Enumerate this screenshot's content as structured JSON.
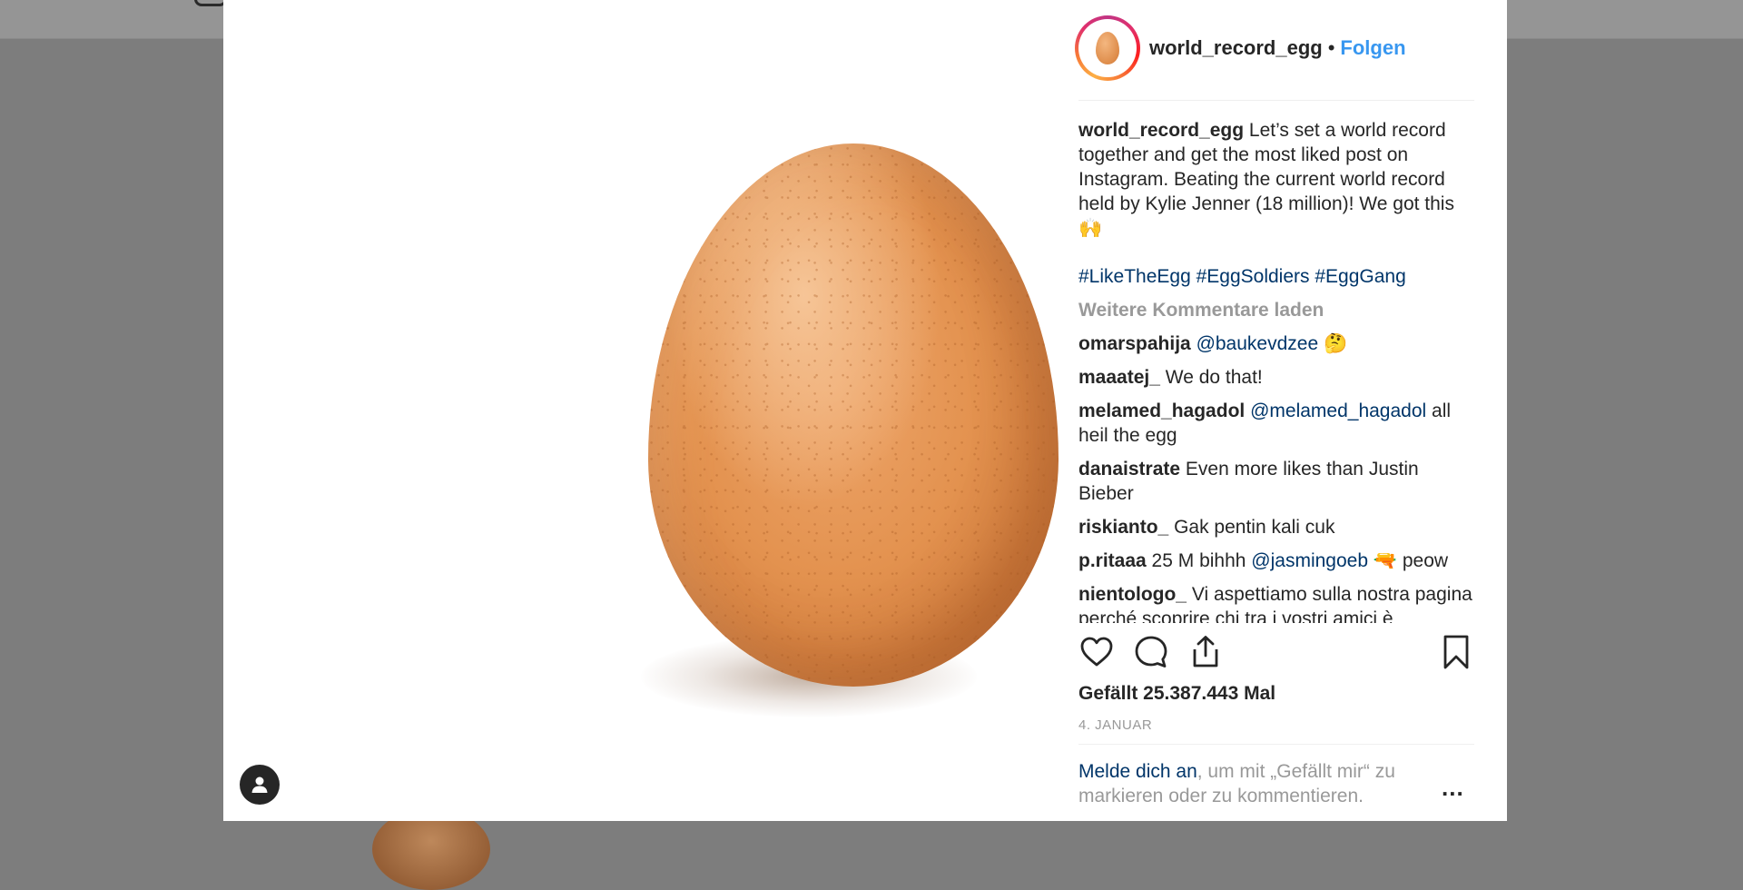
{
  "post": {
    "username": "world_record_egg",
    "separator": "•",
    "follow_label": "Folgen",
    "caption_user": "world_record_egg",
    "caption_text": "Let’s set a world record together and get the most liked post on Instagram. Beating the current world record held by Kylie Jenner (18 million)! We got this 🙌",
    "hashtags": [
      "#LikeTheEgg",
      "#EggSoldiers",
      "#EggGang"
    ],
    "load_more_label": "Weitere Kommentare laden",
    "comments": [
      {
        "user": "omarspahija",
        "mention": "@baukevdzee",
        "text": "🤔"
      },
      {
        "user": "maaatej_",
        "mention": "",
        "text": "We do that!"
      },
      {
        "user": "melamed_hagadol",
        "mention": "@melamed_hagadol",
        "text": "all heil the egg"
      },
      {
        "user": "danaistrate",
        "mention": "",
        "text": "Even more likes than Justin Bieber"
      },
      {
        "user": "riskianto_",
        "mention": "",
        "text": "Gak pentin kali cuk"
      },
      {
        "user": "p.ritaaa",
        "mention": "@jasmingoeb",
        "pre": "25 M bihhh",
        "text": "🔫 peow"
      },
      {
        "user": "nientologo_",
        "mention": "",
        "text": "Vi aspettiamo sulla nostra pagina perché scoprire chi tra i vostri amici è"
      }
    ],
    "likes_label": "Gefällt 25.387.443 Mal",
    "date_label": "4. JANUAR",
    "login_link": "Melde dich an",
    "login_rest": ", um mit „Gefällt mir“ zu markieren oder zu kommentieren.",
    "more_options": "..."
  },
  "icons": {
    "like": "heart-icon",
    "comment": "comment-bubble-icon",
    "share": "share-icon",
    "save": "bookmark-icon",
    "profile": "person-icon"
  },
  "colors": {
    "link_blue": "#3897f0",
    "hashtag_blue": "#003569",
    "muted": "#999999",
    "text": "#262626"
  }
}
